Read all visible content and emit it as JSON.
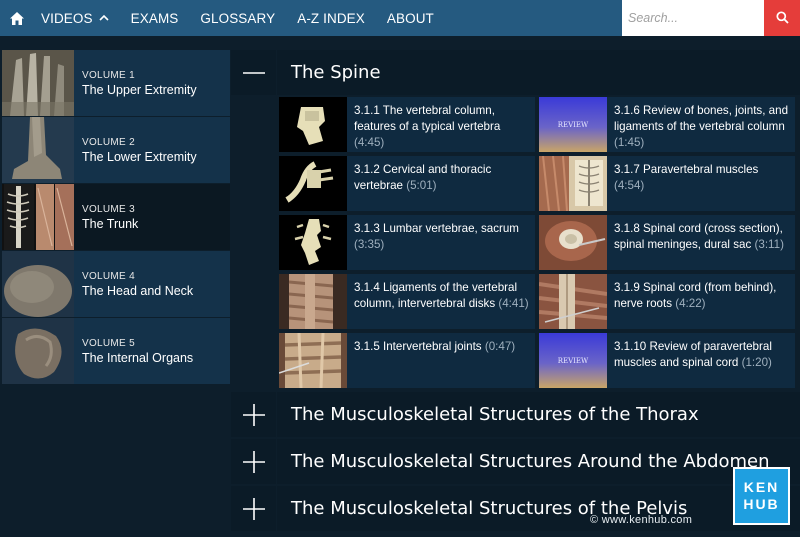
{
  "nav": {
    "home_icon": "home-icon",
    "items": [
      {
        "label": "VIDEOS",
        "chevron": "chevron-up-icon"
      },
      {
        "label": "EXAMS"
      },
      {
        "label": "GLOSSARY"
      },
      {
        "label": "A-Z INDEX"
      },
      {
        "label": "ABOUT"
      }
    ],
    "search_placeholder": "Search...",
    "search_icon": "magnifier-icon",
    "accent": "#255a80",
    "search_button_color": "#e53d3a"
  },
  "sidebar": {
    "volumes": [
      {
        "number": "VOLUME 1",
        "name": "The Upper Extremity"
      },
      {
        "number": "VOLUME 2",
        "name": "The Lower Extremity"
      },
      {
        "number": "VOLUME 3",
        "name": "The Trunk",
        "active": true
      },
      {
        "number": "VOLUME 4",
        "name": "The Head and Neck"
      },
      {
        "number": "VOLUME 5",
        "name": "The Internal Organs"
      }
    ]
  },
  "main": {
    "sections": [
      {
        "title": "The Spine",
        "expanded": true,
        "icon": "minus-icon"
      },
      {
        "title": "The Musculoskeletal Structures of the Thorax",
        "expanded": false,
        "icon": "plus-icon"
      },
      {
        "title": "The Musculoskeletal Structures Around the Abdomen",
        "expanded": false,
        "icon": "plus-icon"
      },
      {
        "title": "The Musculoskeletal Structures of the Pelvis",
        "expanded": false,
        "icon": "plus-icon"
      }
    ],
    "lessons": [
      {
        "title": "3.1.1 The vertebral column, features of a typical vertebra",
        "duration": "(4:45)"
      },
      {
        "title": "3.1.6 Review of bones, joints, and ligaments of the vertebral column",
        "duration": "(1:45)",
        "thumb_label": "REVIEW"
      },
      {
        "title": "3.1.2 Cervical and thoracic vertebrae",
        "duration": "(5:01)"
      },
      {
        "title": "3.1.7 Paravertebral muscles",
        "duration": "(4:54)"
      },
      {
        "title": "3.1.3 Lumbar vertebrae, sacrum",
        "duration": "(3:35)"
      },
      {
        "title": "3.1.8 Spinal cord (cross section), spinal meninges, dural sac",
        "duration": "(3:11)"
      },
      {
        "title": "3.1.4 Ligaments of the vertebral column, intervertebral disks",
        "duration": "(4:41)"
      },
      {
        "title": "3.1.9 Spinal cord (from behind), nerve roots",
        "duration": "(4:22)"
      },
      {
        "title": "3.1.5 Intervertebral joints",
        "duration": "(0:47)"
      },
      {
        "title": "3.1.10 Review of paravertebral muscles and spinal cord",
        "duration": "(1:20)",
        "thumb_label": "REVIEW"
      }
    ]
  },
  "footer": {
    "watermark": "© www.kenhub.com",
    "logo_line1": "KEN",
    "logo_line2": "HUB",
    "logo_color": "#1f9fe0"
  }
}
